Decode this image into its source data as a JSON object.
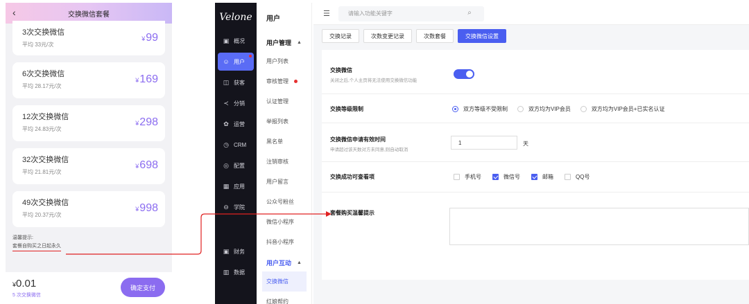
{
  "mobile": {
    "title": "交换微信套餐",
    "back_icon": "chevron-left-icon",
    "packages": [
      {
        "name": "3次交换微信",
        "avg": "平均 33元/次",
        "currency": "¥",
        "price": "99"
      },
      {
        "name": "6次交换微信",
        "avg": "平均 28.17元/次",
        "currency": "¥",
        "price": "169"
      },
      {
        "name": "12次交换微信",
        "avg": "平均 24.83元/次",
        "currency": "¥",
        "price": "298"
      },
      {
        "name": "32次交换微信",
        "avg": "平均 21.81元/次",
        "currency": "¥",
        "price": "698"
      },
      {
        "name": "49次交换微信",
        "avg": "平均 20.37元/次",
        "currency": "¥",
        "price": "998"
      }
    ],
    "tip_title": "温馨提示:",
    "tip_text": "套餐自购买之日起永久",
    "total_currency": "¥",
    "total": "0.01",
    "total_sub": "5 次交换微信",
    "pay_label": "确定支付"
  },
  "sidebar": {
    "logo": "Velone",
    "items": [
      {
        "icon": "dashboard-icon",
        "glyph": "▣",
        "label": "概况"
      },
      {
        "icon": "user-icon",
        "glyph": "☺",
        "label": "用户"
      },
      {
        "icon": "acquire-icon",
        "glyph": "◫",
        "label": "获客"
      },
      {
        "icon": "share-icon",
        "glyph": "≺",
        "label": "分销"
      },
      {
        "icon": "operation-icon",
        "glyph": "✿",
        "label": "运营"
      },
      {
        "icon": "crm-icon",
        "glyph": "◷",
        "label": "CRM"
      },
      {
        "icon": "config-icon",
        "glyph": "◎",
        "label": "配置"
      },
      {
        "icon": "apps-icon",
        "glyph": "▦",
        "label": "应用"
      },
      {
        "icon": "academy-icon",
        "glyph": "⊖",
        "label": "学院"
      },
      {
        "icon": "finance-icon",
        "glyph": "▣",
        "label": "财务"
      },
      {
        "icon": "data-icon",
        "glyph": "▥",
        "label": "数据"
      }
    ]
  },
  "subnav": {
    "title": "用户",
    "group1": "用户管理",
    "items1": [
      "用户列表",
      "审核管理",
      "认证管理",
      "举报列表",
      "黑名单",
      "注销审核",
      "用户留言",
      "公众号粉丝",
      "微信小程序",
      "抖音小程序"
    ],
    "group2": "用户互动",
    "items2": [
      "交换微信",
      "红娘帮约"
    ]
  },
  "topbar": {
    "search_placeholder": "请输入功能关键字"
  },
  "tabs": [
    "交换记录",
    "次数变更记录",
    "次数套餐",
    "交换微信设置"
  ],
  "settings": {
    "switch_label": "交换微信",
    "switch_desc": "关闭之后,个人主页将无法使用交换微信功能",
    "switch_on": true,
    "level_label": "交换等级限制",
    "level_options": [
      "双方等级不受限制",
      "双方均为VIP会员",
      "双方均为VIP会员+已实名认证"
    ],
    "level_selected": 0,
    "expire_label": "交换微信申请有效时间",
    "expire_desc": "申请超过该天数对方未同意,则自动取消",
    "expire_value": "1",
    "expire_unit": "天",
    "visible_label": "交换成功可查看项",
    "visible_options": [
      {
        "label": "手机号",
        "checked": false
      },
      {
        "label": "微信号",
        "checked": true
      },
      {
        "label": "邮箱",
        "checked": true
      },
      {
        "label": "QQ号",
        "checked": false
      }
    ],
    "tip_label": "套餐购买温馨提示",
    "tip_value": ""
  },
  "colors": {
    "accent": "#4a5ef0",
    "price": "#8b6cf0",
    "annotation": "#e02020"
  }
}
